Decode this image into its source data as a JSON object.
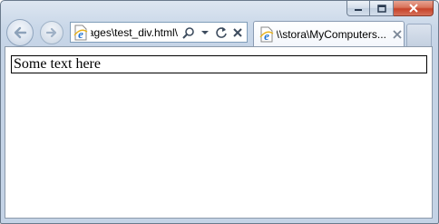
{
  "browser": {
    "address": {
      "url": "\\pages\\test_div.html"
    },
    "tabs": [
      {
        "label": "\\\\stora\\MyComputers...",
        "active": true
      }
    ],
    "caption_buttons": [
      "minimize",
      "maximize",
      "close"
    ],
    "icons": {
      "back": "back-arrow-icon",
      "forward": "forward-arrow-icon",
      "page": "ie-page-icon",
      "search": "search-icon",
      "dropdown": "dropdown-arrow-icon",
      "refresh": "refresh-icon",
      "stop": "stop-icon",
      "tab_close": "close-icon"
    }
  },
  "page": {
    "div_text": "Some text here"
  }
}
